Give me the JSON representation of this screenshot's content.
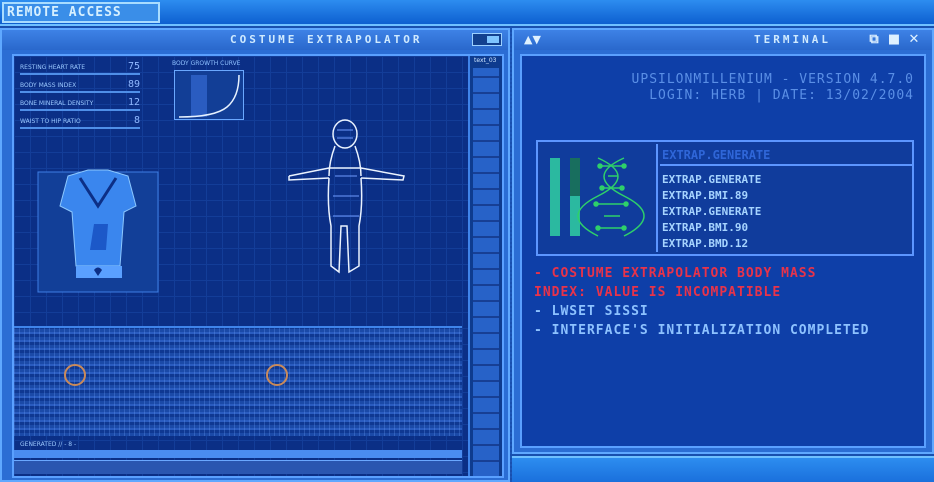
{
  "desktop": {
    "remote_access_label": "REMOTE ACCESS"
  },
  "left_window": {
    "title": "COSTUME EXTRAPOLATOR",
    "stats": [
      {
        "label": "RESTING HEART RATE",
        "value": "75"
      },
      {
        "label": "BODY MASS INDEX",
        "value": "89"
      },
      {
        "label": "BONE MINERAL DENSITY",
        "value": "12"
      },
      {
        "label": "WAIST TO HIP RATIO",
        "value": "8"
      }
    ],
    "curve_label": "BODY GROWTH CURVE",
    "generated_label": "GENERATED // - 8 -",
    "col_label": "text_03"
  },
  "right_window": {
    "title": "TERMINAL",
    "header_line1": "UPSILONMILLENIUM - VERSION 4.7.0",
    "header_line2": "LOGIN: HERB | DATE: 13/02/2004",
    "command_head": "EXTRAP.GENERATE",
    "commands": [
      "EXTRAP.GENERATE",
      "EXTRAP.BMI.89",
      "EXTRAP.GENERATE",
      "EXTRAP.BMI.90",
      "EXTRAP.BMD.12"
    ],
    "messages": [
      {
        "type": "err",
        "text": "- COSTUME EXTRAPOLATOR BODY MASS"
      },
      {
        "type": "err",
        "text": "INDEX: VALUE IS INCOMPATIBLE"
      },
      {
        "type": "ok",
        "text": "- LWSET SISSI"
      },
      {
        "type": "ok",
        "text": "- INTERFACE'S INITIALIZATION COMPLETED"
      }
    ]
  },
  "colors": {
    "accent": "#5fa8ff",
    "error": "#e8334a",
    "panel": "#0e3fa8"
  }
}
